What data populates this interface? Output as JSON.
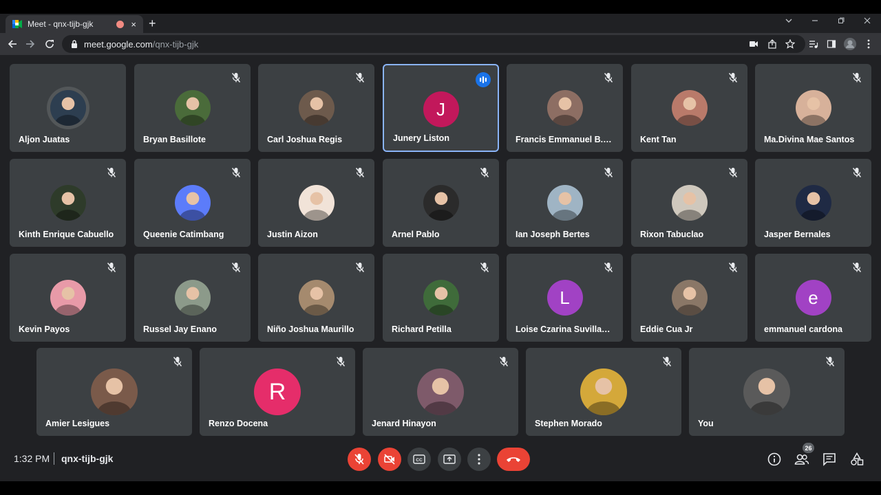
{
  "browser": {
    "tab_title": "Meet - qnx-tijb-gjk",
    "new_tab_symbol": "+",
    "close_tab_symbol": "×",
    "url_host": "meet.google.com",
    "url_path": "/qnx-tijb-gjk"
  },
  "participants_rows": [
    [
      {
        "name": "Aljon Juatas",
        "avatar": "photo",
        "color": "#2d3e50",
        "muted": false,
        "ring": true
      },
      {
        "name": "Bryan Basillote",
        "avatar": "photo",
        "color": "#4a6b3a",
        "muted": true
      },
      {
        "name": "Carl Joshua Regis",
        "avatar": "photo",
        "color": "#6d5a4c",
        "muted": true
      },
      {
        "name": "Junery Liston",
        "avatar": "letter",
        "letter": "J",
        "color": "#c2185b",
        "muted": false,
        "speaking": true
      },
      {
        "name": "Francis Emmanuel B. Pe...",
        "avatar": "photo",
        "color": "#8d6e63",
        "muted": true
      },
      {
        "name": "Kent Tan",
        "avatar": "photo",
        "color": "#b97a6a",
        "muted": true
      },
      {
        "name": "Ma.Divina Mae Santos",
        "avatar": "photo",
        "color": "#d7b19a",
        "muted": true
      }
    ],
    [
      {
        "name": "Kinth Enrique Cabuello",
        "avatar": "photo",
        "color": "#2e3b2a",
        "muted": true
      },
      {
        "name": "Queenie Catimbang",
        "avatar": "photo",
        "color": "#5c7cfa",
        "muted": true
      },
      {
        "name": "Justin Aizon",
        "avatar": "photo",
        "color": "#f1e3d8",
        "muted": true
      },
      {
        "name": "Arnel Pablo",
        "avatar": "photo",
        "color": "#2b2b2b",
        "muted": true
      },
      {
        "name": "Ian Joseph Bertes",
        "avatar": "photo",
        "color": "#9fb4c4",
        "muted": true
      },
      {
        "name": "Rixon Tabuclao",
        "avatar": "photo",
        "color": "#cfc8bd",
        "muted": true
      },
      {
        "name": "Jasper Bernales",
        "avatar": "photo",
        "color": "#1f2a44",
        "muted": true
      }
    ],
    [
      {
        "name": "Kevin Payos",
        "avatar": "photo",
        "color": "#e89aa8",
        "muted": true
      },
      {
        "name": "Russel Jay Enano",
        "avatar": "photo",
        "color": "#8c9a8a",
        "muted": true
      },
      {
        "name": "Niño Joshua Maurillo",
        "avatar": "photo",
        "color": "#a58a6e",
        "muted": true
      },
      {
        "name": "Richard Petilla",
        "avatar": "photo",
        "color": "#3f6b3a",
        "muted": true
      },
      {
        "name": "Loise Czarina Suvillaga I...",
        "avatar": "letter",
        "letter": "L",
        "color": "#a142c4",
        "muted": true
      },
      {
        "name": "Eddie Cua Jr",
        "avatar": "photo",
        "color": "#8a7767",
        "muted": true
      },
      {
        "name": "emmanuel cardona",
        "avatar": "letter",
        "letter": "e",
        "color": "#a142c4",
        "muted": true
      }
    ],
    [
      {
        "name": "Amier Lesigues",
        "avatar": "photo",
        "color": "#7a5a4a",
        "muted": true
      },
      {
        "name": "Renzo Docena",
        "avatar": "letter",
        "letter": "R",
        "color": "#e52d6a",
        "muted": true
      },
      {
        "name": "Jenard Hinayon",
        "avatar": "photo",
        "color": "#7e5a6a",
        "muted": true
      },
      {
        "name": "Stephen Morado",
        "avatar": "photo",
        "color": "#d4a83a",
        "muted": true
      },
      {
        "name": "You",
        "avatar": "photo",
        "color": "#5a5a5a",
        "muted": true
      }
    ]
  ],
  "bottom_bar": {
    "time": "1:32 PM",
    "meeting_code": "qnx-tijb-gjk",
    "participant_count": "26"
  },
  "colors": {
    "meet_bg": "#202124",
    "tile_bg": "#3c4043",
    "danger": "#ea4335",
    "speaking": "#8ab4f8"
  }
}
